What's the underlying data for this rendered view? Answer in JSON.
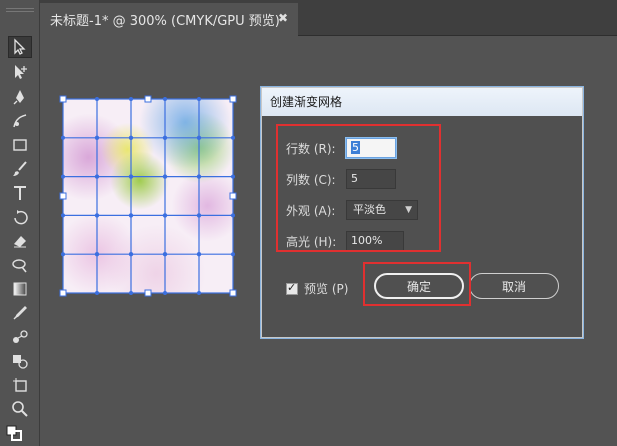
{
  "tab": {
    "title": "未标题-1* @ 300% (CMYK/GPU 预览)",
    "close_label": "✖"
  },
  "mesh": {
    "rows": 5,
    "columns": 5
  },
  "dialog": {
    "title": "创建渐变网格",
    "rows_label": "行数 (R):",
    "rows_value": "5",
    "columns_label": "列数 (C):",
    "columns_value": "5",
    "appearance_label": "外观 (A):",
    "appearance_value": "平淡色",
    "highlight_label": "高光 (H):",
    "highlight_value": "100%",
    "preview_label": "预览 (P)",
    "preview_checked": true,
    "ok_label": "确定",
    "cancel_label": "取消"
  },
  "colors": {
    "highlight_box": "#e03030",
    "mesh_line": "#3b6fe0",
    "panel": "#535353"
  }
}
